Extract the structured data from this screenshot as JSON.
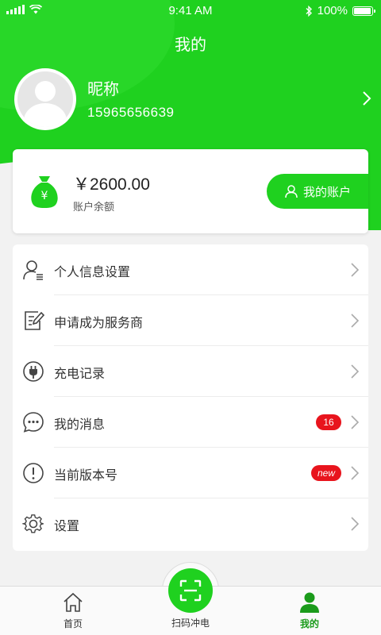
{
  "status_bar": {
    "time": "9:41 AM",
    "battery": "100%",
    "battery_level": 1.0
  },
  "header": {
    "title": "我的"
  },
  "profile": {
    "nickname": "昵称",
    "phone": "15965656639"
  },
  "balance": {
    "amount": "￥2600.00",
    "label": "账户余额",
    "account_button": "我的账户",
    "money_icon_glyph": "¥"
  },
  "menu": {
    "items": [
      {
        "label": "个人信息设置",
        "icon": "user-settings-icon"
      },
      {
        "label": "申请成为服务商",
        "icon": "edit-form-icon"
      },
      {
        "label": "充电记录",
        "icon": "plug-icon"
      },
      {
        "label": "我的消息",
        "icon": "message-icon",
        "badge": "16"
      },
      {
        "label": "当前版本号",
        "icon": "info-icon",
        "badge": "new"
      },
      {
        "label": "设置",
        "icon": "gear-icon"
      }
    ]
  },
  "tabbar": {
    "home": "首页",
    "scan": "扫码冲电",
    "mine": "我的"
  },
  "colors": {
    "accent": "#1fd11f",
    "badge": "#e8141d",
    "active_tab": "#1b9b1b"
  }
}
